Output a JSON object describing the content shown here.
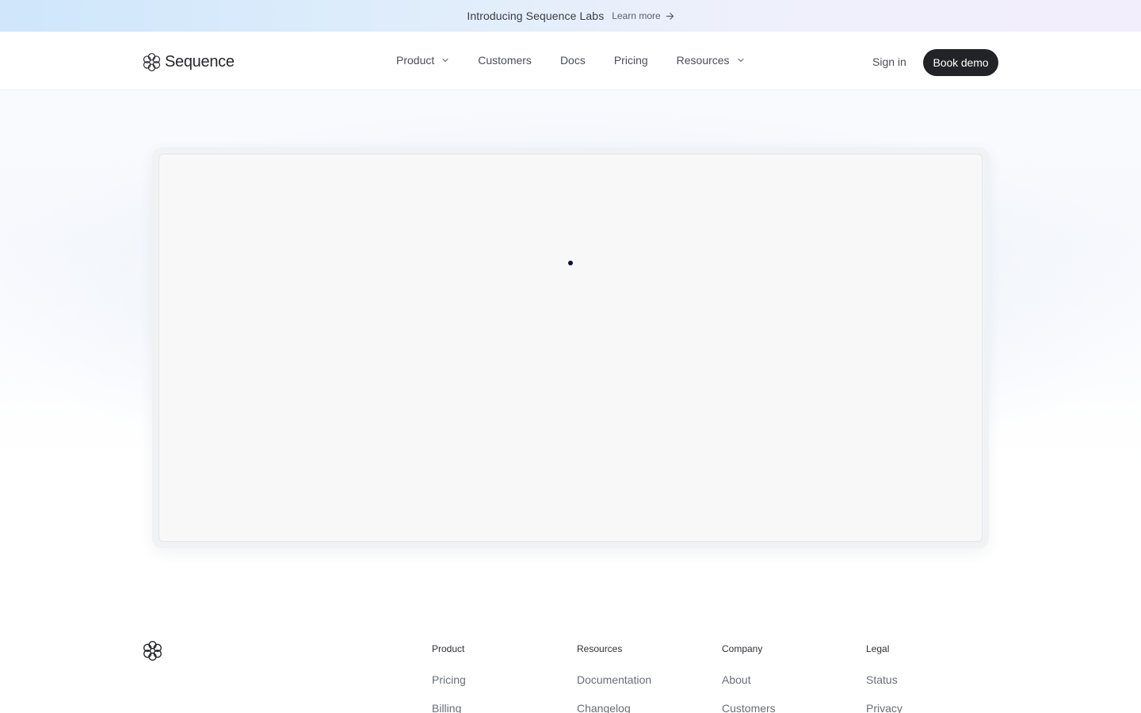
{
  "announcement": {
    "text": "Introducing Sequence Labs",
    "link_label": "Learn more"
  },
  "header": {
    "logo_text": "Sequence",
    "nav": [
      {
        "label": "Product",
        "has_dropdown": true
      },
      {
        "label": "Customers",
        "has_dropdown": false
      },
      {
        "label": "Docs",
        "has_dropdown": false
      },
      {
        "label": "Pricing",
        "has_dropdown": false
      },
      {
        "label": "Resources",
        "has_dropdown": true
      }
    ],
    "sign_in_label": "Sign in",
    "cta_label": "Book demo"
  },
  "footer": {
    "columns": [
      {
        "heading": "Product",
        "links": [
          "Pricing",
          "Billing"
        ]
      },
      {
        "heading": "Resources",
        "links": [
          "Documentation",
          "Changelog"
        ]
      },
      {
        "heading": "Company",
        "links": [
          "About",
          "Customers"
        ]
      },
      {
        "heading": "Legal",
        "links": [
          "Status",
          "Privacy"
        ]
      }
    ]
  },
  "colors": {
    "cta_bg": "#222326",
    "loader": "#0d1330",
    "announcement_gradient_start": "#cfe6fb",
    "announcement_gradient_end": "#f3eefb"
  }
}
